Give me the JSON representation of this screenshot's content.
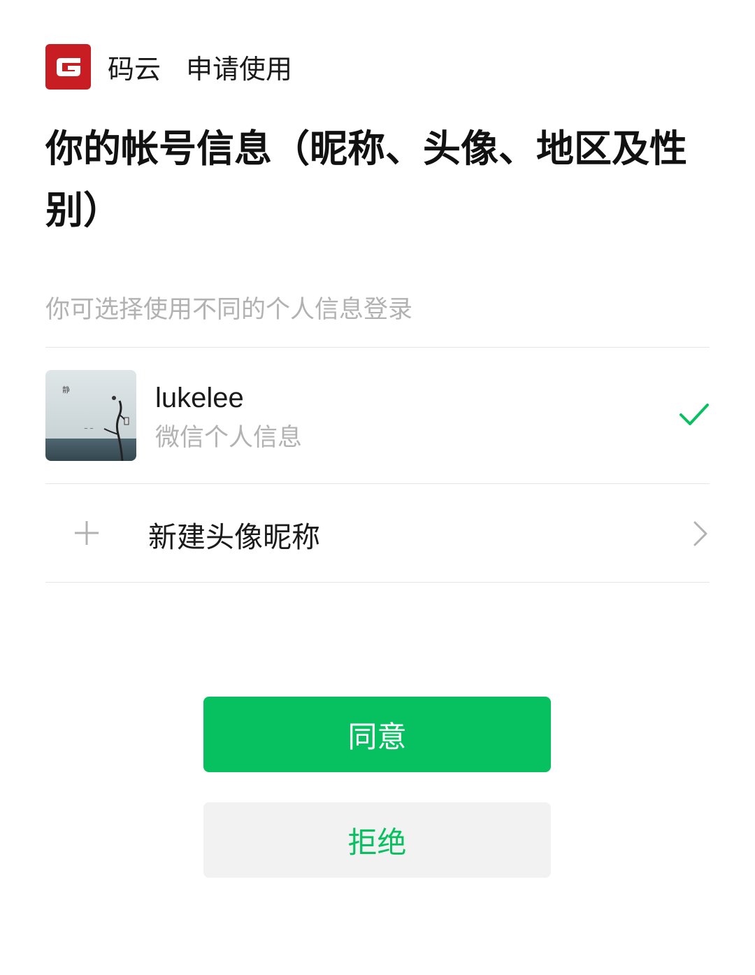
{
  "header": {
    "app_name": "码云",
    "request_text": "申请使用",
    "logo_icon": "gitee-logo-icon",
    "logo_color": "#c71d23"
  },
  "title": "你的帐号信息（昵称、头像、地区及性别）",
  "subtitle": "你可选择使用不同的个人信息登录",
  "account": {
    "nickname": "lukelee",
    "description": "微信个人信息",
    "selected": true
  },
  "new_profile": {
    "label": "新建头像昵称"
  },
  "buttons": {
    "agree": "同意",
    "reject": "拒绝"
  },
  "colors": {
    "accent": "#07c160",
    "secondary_text": "#b2b2b2",
    "divider": "#e5e5e5"
  }
}
